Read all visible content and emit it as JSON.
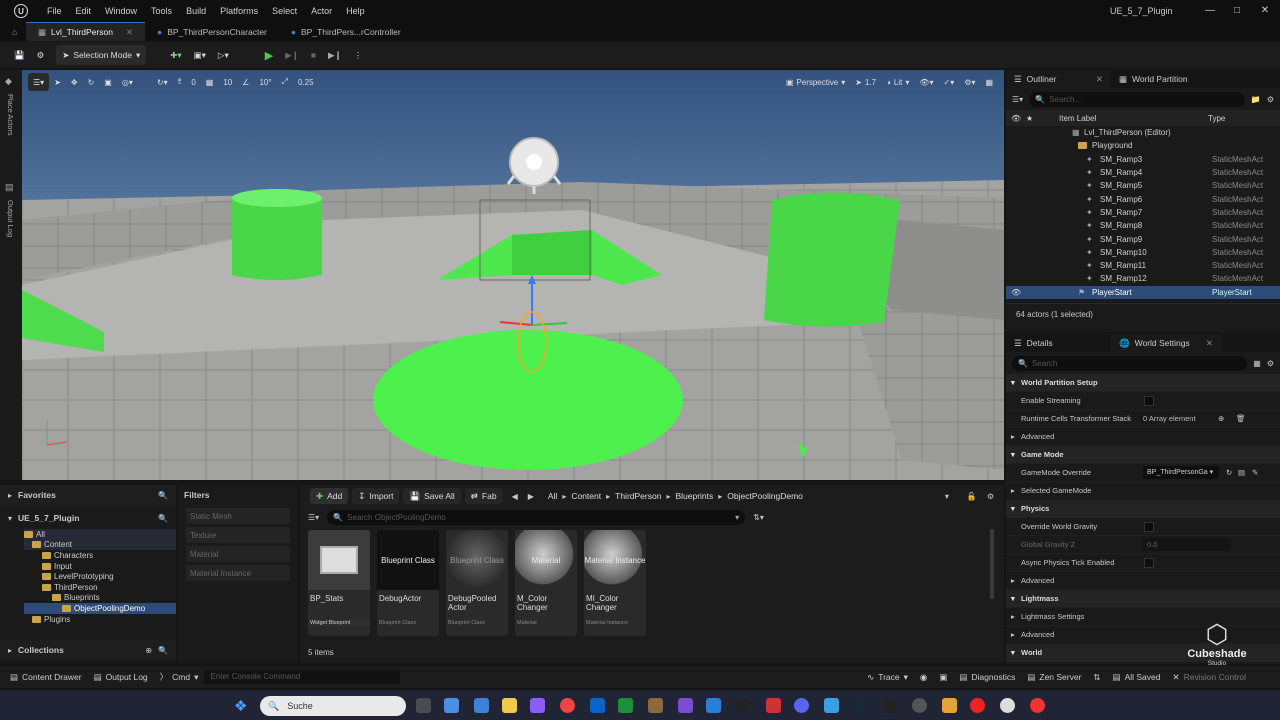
{
  "window": {
    "title": "UE_5_7_Plugin",
    "menu": [
      "File",
      "Edit",
      "Window",
      "Tools",
      "Build",
      "Platforms",
      "Select",
      "Actor",
      "Help"
    ]
  },
  "tabs": [
    "Lvl_ThirdPerson",
    "BP_ThirdPersonCharacter",
    "BP_ThirdPers...rController"
  ],
  "toolbar": {
    "selection_mode": "Selection Mode"
  },
  "left_strip": {
    "place_actors": "Place Actors",
    "output_log": "Output Log"
  },
  "viewport": {
    "snap_translate": "0",
    "grid_size": "10",
    "rotation": "10°",
    "scale": "0.25",
    "view_mode_perspective": "Perspective",
    "view_mode_lit": "Lit",
    "camera_speed": "1.7"
  },
  "outliner": {
    "tab_label": "Outliner",
    "tab2_label": "World Partition",
    "search_placeholder": "Search...",
    "col_label": "Item Label",
    "col_type": "Type",
    "root": "Lvl_ThirdPerson (Editor)",
    "folder": "Playground",
    "rows": [
      {
        "name": "SM_Ramp3",
        "type": "StaticMeshAct"
      },
      {
        "name": "SM_Ramp4",
        "type": "StaticMeshAct"
      },
      {
        "name": "SM_Ramp5",
        "type": "StaticMeshAct"
      },
      {
        "name": "SM_Ramp6",
        "type": "StaticMeshAct"
      },
      {
        "name": "SM_Ramp7",
        "type": "StaticMeshAct"
      },
      {
        "name": "SM_Ramp8",
        "type": "StaticMeshAct"
      },
      {
        "name": "SM_Ramp9",
        "type": "StaticMeshAct"
      },
      {
        "name": "SM_Ramp10",
        "type": "StaticMeshAct"
      },
      {
        "name": "SM_Ramp11",
        "type": "StaticMeshAct"
      },
      {
        "name": "SM_Ramp12",
        "type": "StaticMeshAct"
      }
    ],
    "selected_row": {
      "name": "PlayerStart",
      "type": "PlayerStart"
    },
    "actor_count": "64 actors (1 selected)"
  },
  "details": {
    "tab_label": "Details",
    "tab2_label": "World Settings",
    "search_placeholder": "Search",
    "sections": {
      "world_partition_setup": "World Partition Setup",
      "enable_streaming": "Enable Streaming",
      "runtime_cells": "Runtime Cells Transformer Stack",
      "runtime_cells_value": "0 Array element",
      "advanced": "Advanced",
      "game_mode": "Game Mode",
      "gamemode_override": "GameMode Override",
      "gamemode_override_value": "BP_ThirdPersonGa",
      "selected_gamemode": "Selected GameMode",
      "physics": "Physics",
      "override_world_gravity": "Override World Gravity",
      "global_gravity_z": "Global Gravity Z",
      "global_gravity_z_value": "0.0",
      "async_physics": "Async Physics Tick Enabled",
      "lightmass": "Lightmass",
      "lightmass_settings": "Lightmass Settings",
      "world": "World"
    }
  },
  "content_browser": {
    "favorites": "Favorites",
    "project": "UE_5_7_Plugin",
    "tree": [
      "All",
      "Content",
      "Characters",
      "Input",
      "LevelPrototyping",
      "ThirdPerson",
      "Blueprints",
      "ObjectPoolingDemo",
      "Plugins"
    ],
    "collections": "Collections",
    "filters_label": "Filters",
    "filter_items": [
      "Static Mesh",
      "Texture",
      "Material",
      "Material Instance"
    ],
    "add": "Add",
    "import": "Import",
    "save_all": "Save All",
    "fab": "Fab",
    "breadcrumbs": [
      "All",
      "Content",
      "ThirdPerson",
      "Blueprints",
      "ObjectPoolingDemo"
    ],
    "search_placeholder": "Search ObjectPoolingDemo",
    "assets": [
      {
        "name": "BP_Stats",
        "type": "Widget Blueprint",
        "thumb": ""
      },
      {
        "name": "DebugActor",
        "type": "Blueprint Class",
        "thumb": "Blueprint Class"
      },
      {
        "name": "DebugPooled Actor",
        "type": "Blueprint Class",
        "thumb": "Blueprint Class"
      },
      {
        "name": "M_Color Changer",
        "type": "Material",
        "thumb": "Material"
      },
      {
        "name": "MI_Color Changer",
        "type": "Material Instance",
        "thumb": "Material Instance"
      }
    ],
    "item_count": "5 items"
  },
  "status_bar": {
    "content_drawer": "Content Drawer",
    "output_log": "Output Log",
    "cmd": "Cmd",
    "console_placeholder": "Enter Console Command",
    "trace": "Trace",
    "diagnostics": "Diagnostics",
    "zen_server": "Zen Server",
    "all_saved": "All Saved",
    "revision_control": "Revision Control"
  },
  "watermark": {
    "brand": "Cubeshade",
    "sub": "Studio"
  },
  "taskbar": {
    "search": "Suche"
  },
  "colors": {
    "accent": "#3a6fb0",
    "green": "#4ee84e",
    "folder": "#c9a44a",
    "selected": "#2e4a78"
  }
}
